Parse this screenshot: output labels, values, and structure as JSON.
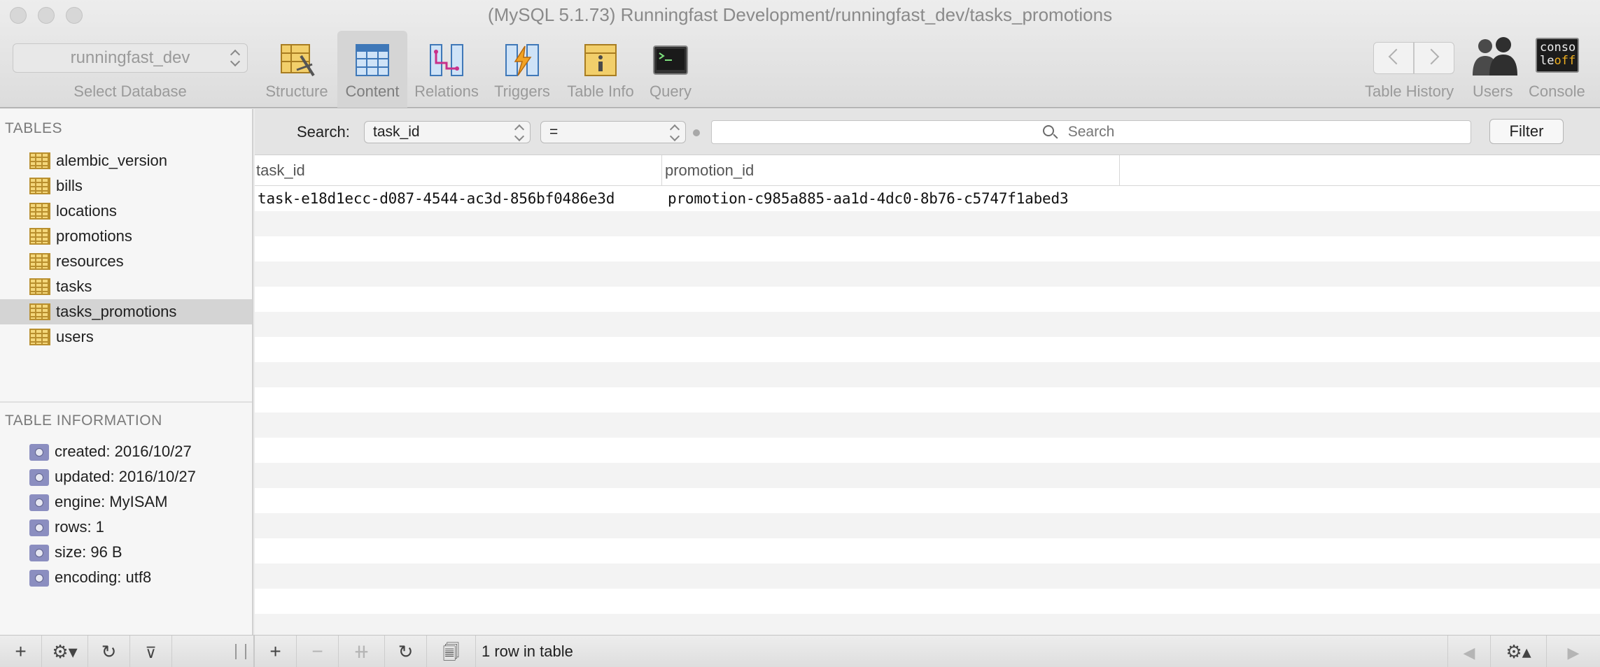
{
  "window": {
    "title": "(MySQL 5.1.73) Runningfast Development/runningfast_dev/tasks_promotions"
  },
  "toolbar": {
    "database_select_value": "runningfast_dev",
    "database_select_label": "Select Database",
    "tools": [
      {
        "label": "Structure",
        "icon": "structure-icon"
      },
      {
        "label": "Content",
        "icon": "content-icon",
        "selected": true
      },
      {
        "label": "Relations",
        "icon": "relations-icon"
      },
      {
        "label": "Triggers",
        "icon": "triggers-icon"
      },
      {
        "label": "Table Info",
        "icon": "table-info-icon"
      },
      {
        "label": "Query",
        "icon": "query-icon"
      }
    ],
    "right": {
      "history_label": "Table History",
      "users_label": "Users",
      "console_label": "Console",
      "console_icon_text": "conso",
      "console_icon_text2": "le",
      "console_icon_text3": "off"
    }
  },
  "sidebar": {
    "tables_header": "TABLES",
    "tables": [
      "alembic_version",
      "bills",
      "locations",
      "promotions",
      "resources",
      "tasks",
      "tasks_promotions",
      "users"
    ],
    "selected_table": "tasks_promotions",
    "info_header": "TABLE INFORMATION",
    "info": [
      "created: 2016/10/27",
      "updated: 2016/10/27",
      "engine: MyISAM",
      "rows: 1",
      "size: 96 B",
      "encoding: utf8"
    ]
  },
  "filter": {
    "label": "Search:",
    "field_value": "task_id",
    "operator_value": "=",
    "search_placeholder": "Search",
    "button_label": "Filter"
  },
  "grid": {
    "columns": [
      "task_id",
      "promotion_id"
    ],
    "rows": [
      [
        "task-e18d1ecc-d087-4544-ac3d-856bf0486e3d",
        "promotion-c985a885-aa1d-4dc0-8b76-c5747f1abed3"
      ]
    ]
  },
  "status": {
    "row_count": "1 row in table"
  },
  "colors": {
    "accent": "#d5d5d5",
    "table_icon": "#f4d77a",
    "info_icon": "#8b8ec0"
  }
}
